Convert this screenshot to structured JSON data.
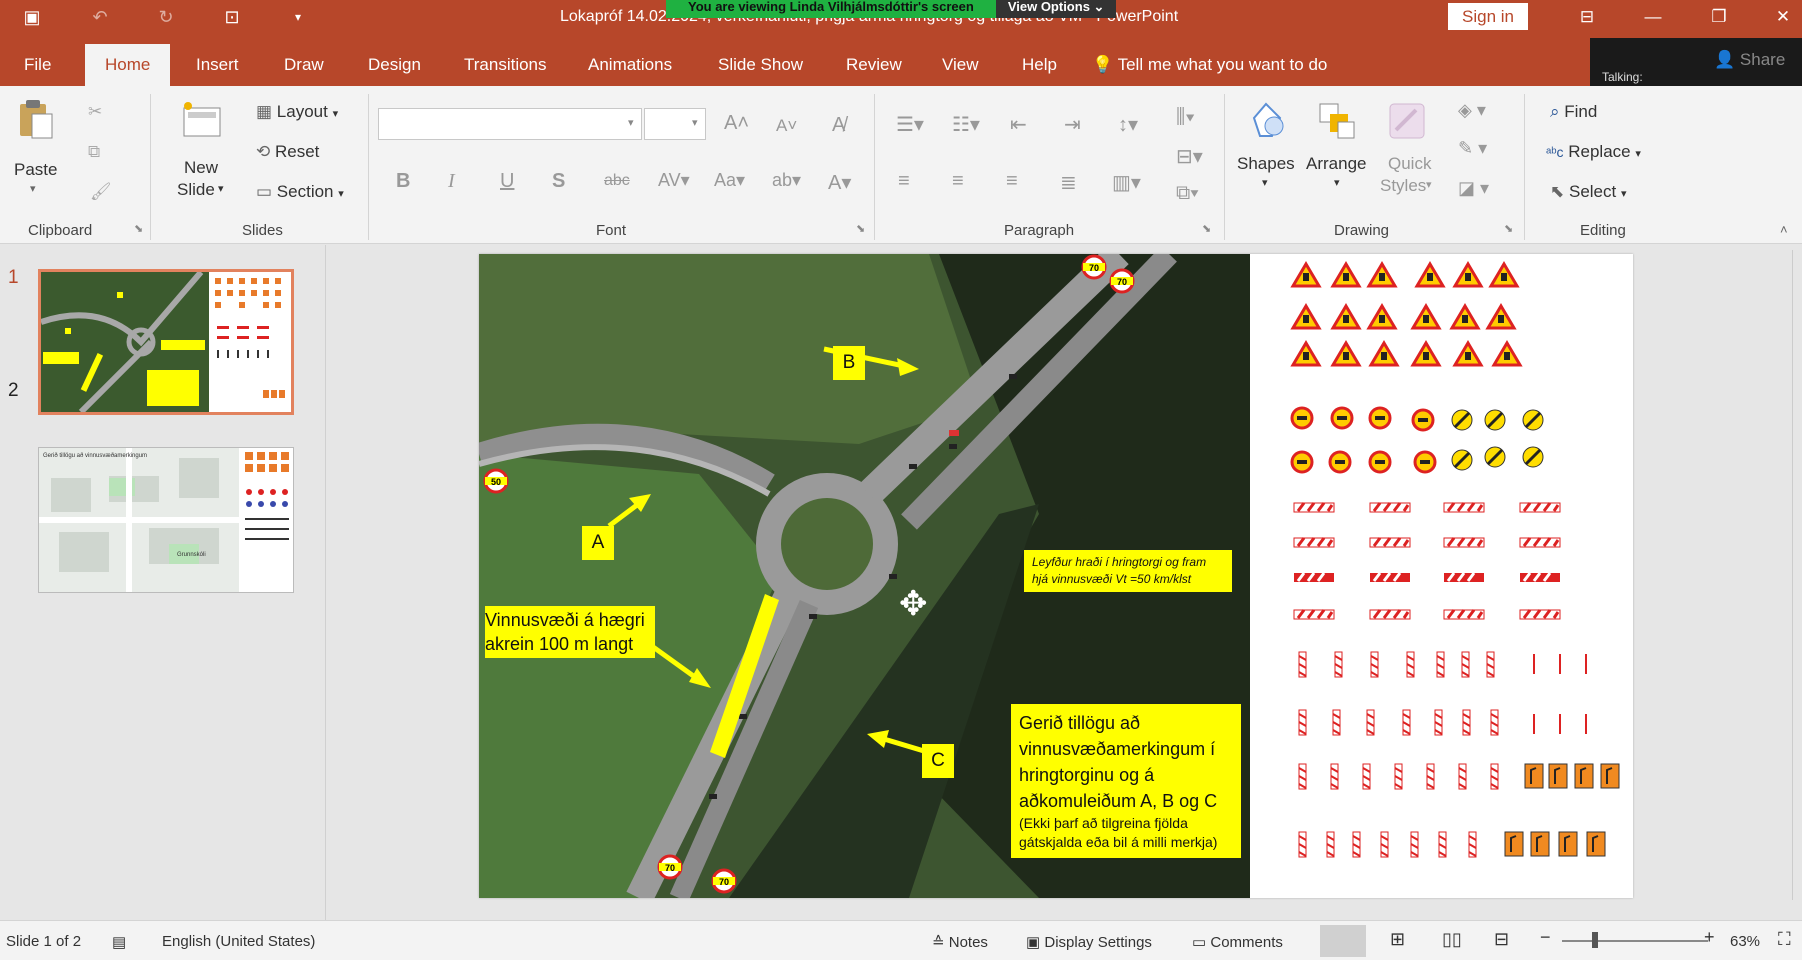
{
  "titlebar": {
    "title": "Lokapróf 14.02.2024, verkefnahluti, þrigja arma hringtorg og tillaga að VM  -  PowerPoint",
    "banner_text": "You are viewing  Linda Vilhjálmsdóttir's screen",
    "view_options": "View Options",
    "sign_in": "Sign in"
  },
  "tabs": [
    "File",
    "Home",
    "Insert",
    "Draw",
    "Design",
    "Transitions",
    "Animations",
    "Slide Show",
    "Review",
    "View",
    "Help"
  ],
  "tell_me": "Tell me what you want to do",
  "talking": "Talking:",
  "share": "Share",
  "ribbon": {
    "clipboard": {
      "label": "Clipboard",
      "paste": "Paste"
    },
    "slides": {
      "label": "Slides",
      "new_slide_1": "New",
      "new_slide_2": "Slide",
      "layout": "Layout",
      "reset": "Reset",
      "section": "Section"
    },
    "font": {
      "label": "Font"
    },
    "paragraph": {
      "label": "Paragraph"
    },
    "drawing": {
      "label": "Drawing",
      "shapes": "Shapes",
      "arrange": "Arrange",
      "quick_1": "Quick",
      "quick_2": "Styles"
    },
    "editing": {
      "label": "Editing",
      "find": "Find",
      "replace": "Replace",
      "select": "Select"
    }
  },
  "thumbnails": [
    {
      "number": "1"
    },
    {
      "number": "2",
      "caption": "Gerið tillögu að vinnusvæðamerkingum",
      "school": "Grunnskóli"
    }
  ],
  "slide": {
    "label_a": "A",
    "label_b": "B",
    "label_c": "C",
    "work_zone": [
      "Vinnusvæði á hægri",
      "akrein  100 m langt"
    ],
    "speed_note": [
      "Leyfður hraði í hringtorgi og fram",
      "hjá vinnusvæði Vt =50 km/klst"
    ],
    "task_lines": [
      "Gerið tillögu að",
      "vinnusvæðamerkingum í",
      "hringtorginu og á",
      "aðkomuleiðum A, B og C"
    ],
    "task_sub": [
      "(Ekki þarf að tilgreina fjölda",
      "gátskjalda eða bil á milli merkja)"
    ],
    "speed_70": "70",
    "speed_50": "50"
  },
  "statusbar": {
    "slide_of": "Slide 1 of 2",
    "language": "English (United States)",
    "notes": "Notes",
    "display": "Display Settings",
    "comments": "Comments",
    "zoom": "63%"
  }
}
